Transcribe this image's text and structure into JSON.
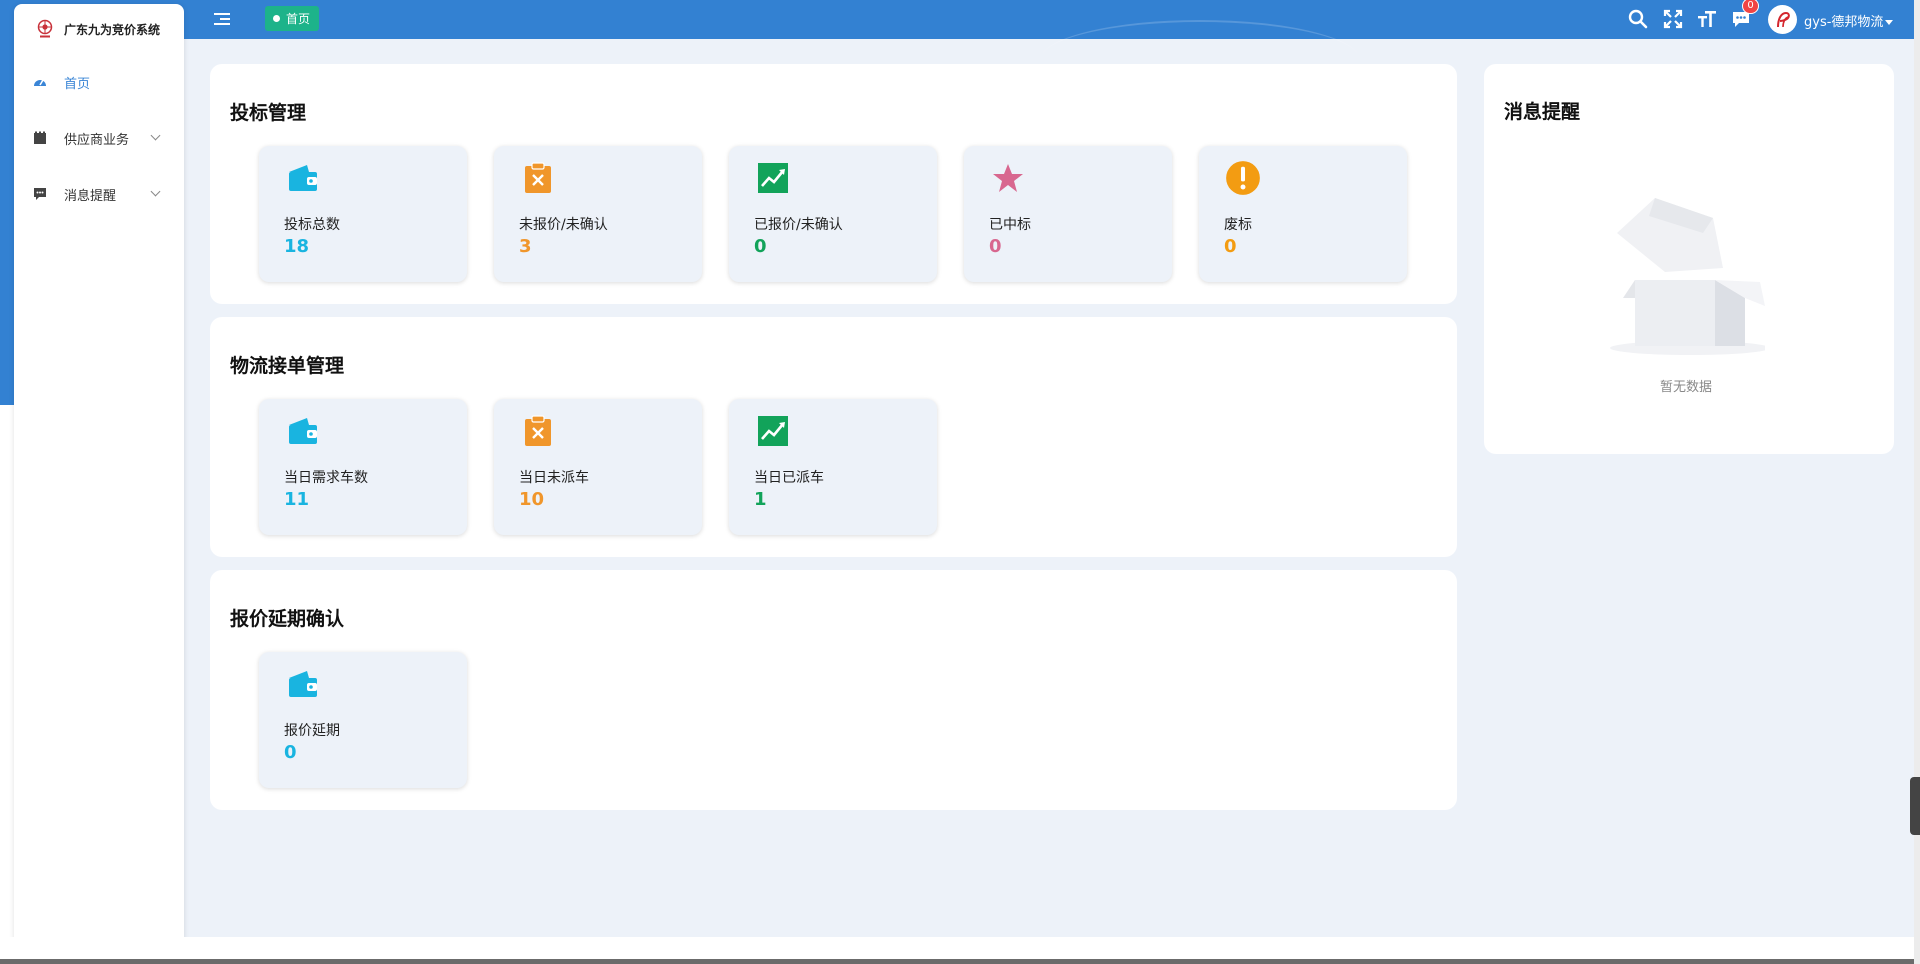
{
  "header": {
    "current_tag": "首页",
    "message_badge": "0",
    "user_name": "gys-德邦物流"
  },
  "sidebar": {
    "logo_text": "广东九为竞价系统",
    "items": [
      {
        "label": "首页",
        "icon": "dashboard-icon",
        "active": true
      },
      {
        "label": "供应商业务",
        "icon": "film-icon"
      },
      {
        "label": "消息提醒",
        "icon": "chat-icon"
      }
    ]
  },
  "bidding": {
    "title": "投标管理",
    "stats": [
      {
        "label": "投标总数",
        "value": "18",
        "icon": "wallet-icon",
        "color": "#19b4e0"
      },
      {
        "label": "未报价/未确认",
        "value": "3",
        "icon": "clipboard-x-icon",
        "color": "#f0962b"
      },
      {
        "label": "已报价/未确认",
        "value": "0",
        "icon": "trend-chart-icon",
        "color": "#12a35a"
      },
      {
        "label": "已中标",
        "value": "0",
        "icon": "star-icon",
        "color": "#d8678f"
      },
      {
        "label": "废标",
        "value": "0",
        "icon": "warning-icon",
        "color": "#f39c12"
      }
    ]
  },
  "logistics": {
    "title": "物流接单管理",
    "stats": [
      {
        "label": "当日需求车数",
        "value": "11",
        "icon": "wallet-icon",
        "color": "#19b4e0"
      },
      {
        "label": "当日未派车",
        "value": "10",
        "icon": "clipboard-x-icon",
        "color": "#f0962b"
      },
      {
        "label": "当日已派车",
        "value": "1",
        "icon": "trend-chart-icon",
        "color": "#12a35a"
      }
    ]
  },
  "quote_delay": {
    "title": "报价延期确认",
    "stats": [
      {
        "label": "报价延期",
        "value": "0",
        "icon": "wallet-icon",
        "color": "#19b4e0"
      }
    ]
  },
  "messages": {
    "title": "消息提醒",
    "empty_text": "暂无数据"
  }
}
